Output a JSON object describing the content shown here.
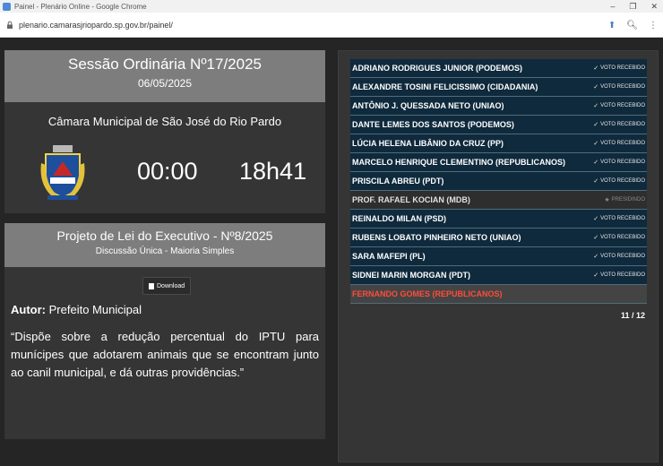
{
  "browser": {
    "window_title": "Painel - Plenário Online - Google Chrome",
    "url": "plenario.camarasjriopardo.sp.gov.br/painel/"
  },
  "session": {
    "title": "Sessão Ordinária Nº17/2025",
    "date": "06/05/2025",
    "chamber": "Câmara Municipal de São José do Rio Pardo",
    "timer": "00:00",
    "clock": "18h41"
  },
  "project": {
    "title": "Projeto de Lei do Executivo - Nº8/2025",
    "subtitle": "Discussão Única - Maioria Simples",
    "download_label": "Download",
    "author_label": "Autor:",
    "author": "Prefeito Municipal",
    "ementa": "“Dispõe sobre a redução percentual do IPTU para munícipes que adotarem animais que se encontram junto ao canil municipal, e dá outras providências.”"
  },
  "voters": [
    {
      "name": "ADRIANO RODRIGUES JUNIOR (PODEMOS)",
      "status": "VOTO RECEBIDO",
      "state": "received"
    },
    {
      "name": "ALEXANDRE TOSINI FELICISSIMO (CIDADANIA)",
      "status": "VOTO RECEBIDO",
      "state": "received"
    },
    {
      "name": "ANTÔNIO J. QUESSADA NETO (UNIAO)",
      "status": "VOTO RECEBIDO",
      "state": "received"
    },
    {
      "name": "DANTE LEMES DOS SANTOS (PODEMOS)",
      "status": "VOTO RECEBIDO",
      "state": "received"
    },
    {
      "name": "LÚCIA HELENA LIBÂNIO DA CRUZ (PP)",
      "status": "VOTO RECEBIDO",
      "state": "received"
    },
    {
      "name": "MARCELO HENRIQUE CLEMENTINO (REPUBLICANOS)",
      "status": "VOTO RECEBIDO",
      "state": "received"
    },
    {
      "name": "PRISCILA ABREU (PDT)",
      "status": "VOTO RECEBIDO",
      "state": "received"
    },
    {
      "name": "PROF. RAFAEL KOCIAN (MDB)",
      "status": "PRESIDINDO",
      "state": "presiding"
    },
    {
      "name": "REINALDO MILAN (PSD)",
      "status": "VOTO RECEBIDO",
      "state": "received"
    },
    {
      "name": "RUBENS LOBATO PINHEIRO NETO (UNIAO)",
      "status": "VOTO RECEBIDO",
      "state": "received"
    },
    {
      "name": "SARA MAFEPI (PL)",
      "status": "VOTO RECEBIDO",
      "state": "received"
    },
    {
      "name": "SIDNEI MARIN MORGAN (PDT)",
      "status": "VOTO RECEBIDO",
      "state": "received"
    },
    {
      "name": "FERNANDO GOMES (REPUBLICANOS)",
      "status": "",
      "state": "absent"
    }
  ],
  "vote_count": "11 / 12",
  "colors": {
    "panel_header": "#7d7d7d",
    "panel_body": "#353535",
    "voted_row": "#0f2a3c",
    "absent_text": "#ff4c3c"
  }
}
